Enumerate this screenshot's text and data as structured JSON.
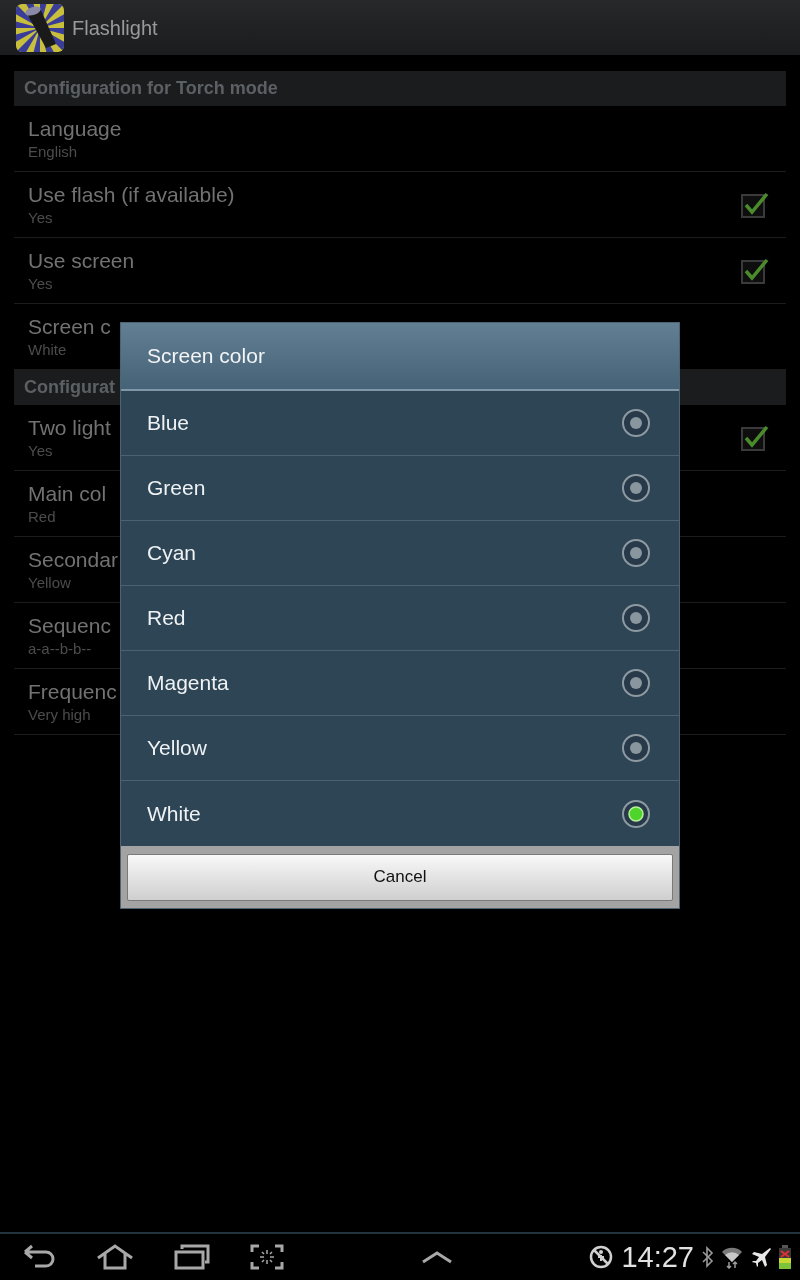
{
  "action_bar": {
    "title": "Flashlight"
  },
  "preferences": [
    {
      "kind": "category",
      "title": "Configuration for Torch mode"
    },
    {
      "kind": "item",
      "title": "Language",
      "summary": "English"
    },
    {
      "kind": "checkbox",
      "title": "Use flash (if available)",
      "summary": "Yes",
      "checked": true
    },
    {
      "kind": "checkbox",
      "title": "Use screen",
      "summary": "Yes",
      "checked": true
    },
    {
      "kind": "item",
      "title": "Screen c",
      "summary": "White"
    },
    {
      "kind": "category",
      "title": "Configurat"
    },
    {
      "kind": "checkbox",
      "title": "Two light",
      "summary": "Yes",
      "checked": true
    },
    {
      "kind": "item",
      "title": "Main col",
      "summary": "Red"
    },
    {
      "kind": "item",
      "title": "Secondar",
      "summary": "Yellow"
    },
    {
      "kind": "item",
      "title": "Sequenc",
      "summary": "a-a--b-b--"
    },
    {
      "kind": "item",
      "title": "Frequenc",
      "summary": "Very high"
    }
  ],
  "dialog": {
    "title": "Screen color",
    "options": [
      {
        "label": "Blue",
        "selected": false
      },
      {
        "label": "Green",
        "selected": false
      },
      {
        "label": "Cyan",
        "selected": false
      },
      {
        "label": "Red",
        "selected": false
      },
      {
        "label": "Magenta",
        "selected": false
      },
      {
        "label": "Yellow",
        "selected": false
      },
      {
        "label": "White",
        "selected": true
      }
    ],
    "button": "Cancel"
  },
  "nav_bar": {
    "time": "14:27"
  }
}
